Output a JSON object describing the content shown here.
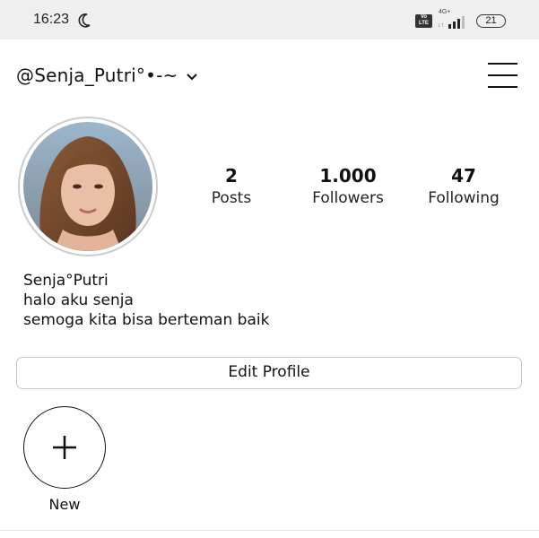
{
  "status_bar": {
    "time": "16:23",
    "volte_label_top": "Vo",
    "volte_label_bottom": "LTE",
    "network_type": "4G+",
    "battery": "21",
    "icons": [
      "moon-icon",
      "volte-icon",
      "signal-icon",
      "battery-icon"
    ]
  },
  "header": {
    "username": "@Senja_Putri°•-~",
    "icons": [
      "chevron-down-icon",
      "hamburger-menu-icon"
    ]
  },
  "profile": {
    "stats": [
      {
        "value": "2",
        "label": "Posts"
      },
      {
        "value": "1.000",
        "label": "Followers"
      },
      {
        "value": "47",
        "label": "Following"
      }
    ],
    "bio": {
      "name": "Senja°Putri",
      "lines": [
        "halo aku senja",
        "semoga kita bisa berteman baik"
      ]
    },
    "edit_button_label": "Edit Profile"
  },
  "highlights": {
    "new_label": "New",
    "icons": [
      "plus-icon"
    ]
  },
  "colors": {
    "status_bar_bg": "#efefef",
    "text": "#111111",
    "border": "#c8c8c8"
  }
}
